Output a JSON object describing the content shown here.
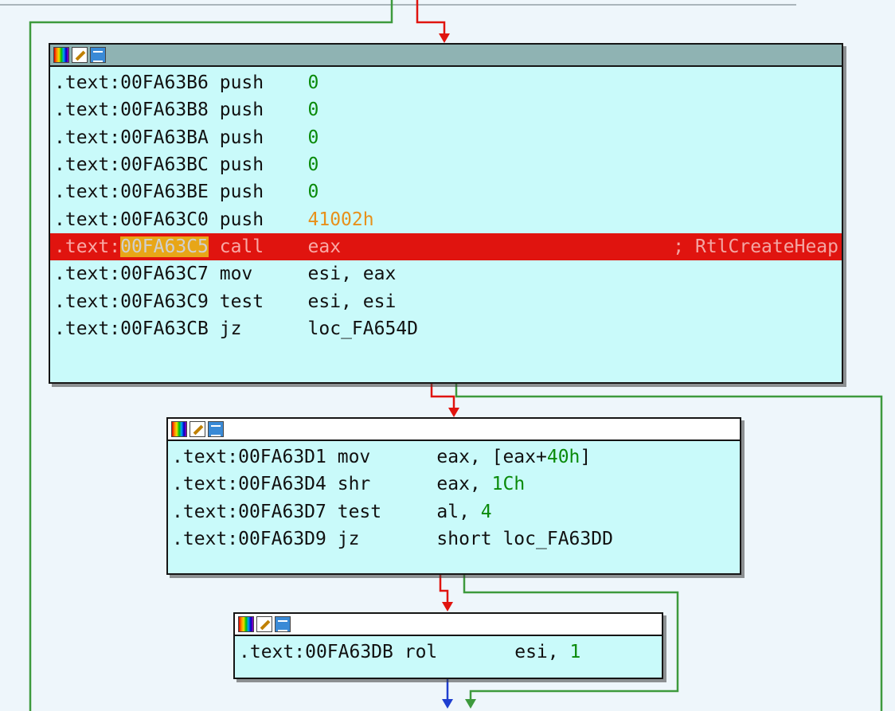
{
  "graph": {
    "blocks": [
      {
        "id": "block-1",
        "header_style": "gray",
        "lines": [
          {
            "prefix": ".text:",
            "addr": "00FA63B6",
            "mnemonic": "push",
            "operand": "0",
            "operand_kind": "num"
          },
          {
            "prefix": ".text:",
            "addr": "00FA63B8",
            "mnemonic": "push",
            "operand": "0",
            "operand_kind": "num"
          },
          {
            "prefix": ".text:",
            "addr": "00FA63BA",
            "mnemonic": "push",
            "operand": "0",
            "operand_kind": "num"
          },
          {
            "prefix": ".text:",
            "addr": "00FA63BC",
            "mnemonic": "push",
            "operand": "0",
            "operand_kind": "num"
          },
          {
            "prefix": ".text:",
            "addr": "00FA63BE",
            "mnemonic": "push",
            "operand": "0",
            "operand_kind": "num"
          },
          {
            "prefix": ".text:",
            "addr": "00FA63C0",
            "mnemonic": "push",
            "operand": "41002h",
            "operand_kind": "imm"
          },
          {
            "prefix": ".text:",
            "addr": "00FA63C5",
            "mnemonic": "call",
            "operand": "eax",
            "operand_kind": "reg",
            "comment": "; RtlCreateHeap",
            "highlighted": true
          },
          {
            "prefix": ".text:",
            "addr": "00FA63C7",
            "mnemonic": "mov",
            "operand": "esi, eax",
            "operand_kind": "reg"
          },
          {
            "prefix": ".text:",
            "addr": "00FA63C9",
            "mnemonic": "test",
            "operand": "esi, esi",
            "operand_kind": "reg"
          },
          {
            "prefix": ".text:",
            "addr": "00FA63CB",
            "mnemonic": "jz",
            "operand": "loc_FA654D",
            "operand_kind": "reg"
          }
        ]
      },
      {
        "id": "block-2",
        "header_style": "white",
        "lines": [
          {
            "prefix": ".text:",
            "addr": "00FA63D1",
            "mnemonic": "mov",
            "operand_parts": [
              [
                "eax, [eax+",
                "reg"
              ],
              [
                "40h",
                "num"
              ],
              [
                "]",
                "reg"
              ]
            ]
          },
          {
            "prefix": ".text:",
            "addr": "00FA63D4",
            "mnemonic": "shr",
            "operand_parts": [
              [
                "eax, ",
                "reg"
              ],
              [
                "1Ch",
                "num"
              ]
            ]
          },
          {
            "prefix": ".text:",
            "addr": "00FA63D7",
            "mnemonic": "test",
            "operand_parts": [
              [
                "al, ",
                "reg"
              ],
              [
                "4",
                "num"
              ]
            ]
          },
          {
            "prefix": ".text:",
            "addr": "00FA63D9",
            "mnemonic": "jz",
            "operand_parts": [
              [
                "short loc_FA63DD",
                "reg"
              ]
            ]
          }
        ]
      },
      {
        "id": "block-3",
        "header_style": "white",
        "lines": [
          {
            "prefix": ".text:",
            "addr": "00FA63DB",
            "mnemonic": "rol",
            "operand_parts": [
              [
                "esi, ",
                "reg"
              ],
              [
                "1",
                "num"
              ]
            ]
          }
        ]
      }
    ],
    "header_icons": [
      "color-palette-icon",
      "edit-node-icon",
      "graph-overview-icon"
    ],
    "colors": {
      "background": "#eef6fb",
      "block_fill": "#c9fafa",
      "highlight_line": "#e0140f",
      "highlight_addr": "#e8a617",
      "edge_true": "#3d9a3d",
      "edge_false": "#e0140f",
      "edge_uncond": "#1f3fd0",
      "number": "#0a8a0a",
      "immediate": "#e8901a"
    }
  }
}
